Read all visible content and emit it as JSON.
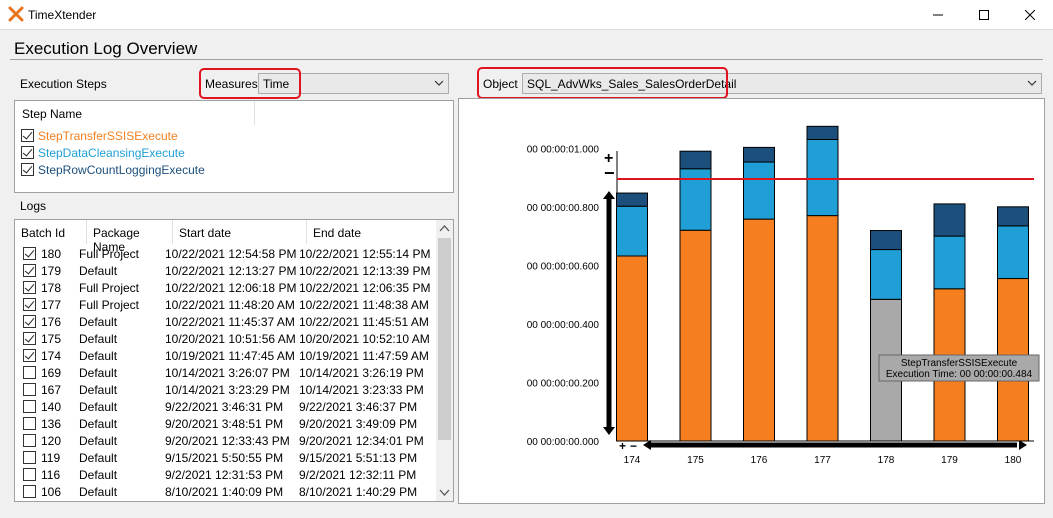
{
  "window": {
    "title": "TimeXtender"
  },
  "page": {
    "heading": "Execution Log Overview"
  },
  "controls": {
    "execution_steps_label": "Execution Steps",
    "measures_label": "Measures",
    "measures_value": "Time",
    "object_label": "Object",
    "object_value": "SQL_AdvWks_Sales_SalesOrderDetail"
  },
  "steps": {
    "header": "Step Name",
    "items": [
      {
        "label": "StepTransferSSISExecute",
        "checked": true,
        "color": "#f57f1f"
      },
      {
        "label": "StepDataCleansingExecute",
        "checked": true,
        "color": "#1f9fd5"
      },
      {
        "label": "StepRowCountLoggingExecute",
        "checked": true,
        "color": "#1c4f7c"
      }
    ]
  },
  "logs": {
    "label": "Logs",
    "columns": [
      "Batch Id",
      "Package Name",
      "Start date",
      "End date"
    ],
    "rows": [
      {
        "checked": true,
        "batch": "180",
        "package": "Full Project",
        "start": "10/22/2021 12:54:58 PM",
        "end": "10/22/2021 12:55:14 PM"
      },
      {
        "checked": true,
        "batch": "179",
        "package": "Default",
        "start": "10/22/2021 12:13:27 PM",
        "end": "10/22/2021 12:13:39 PM"
      },
      {
        "checked": true,
        "batch": "178",
        "package": "Full Project",
        "start": "10/22/2021 12:06:18 PM",
        "end": "10/22/2021 12:06:35 PM"
      },
      {
        "checked": true,
        "batch": "177",
        "package": "Full Project",
        "start": "10/22/2021 11:48:20 AM",
        "end": "10/22/2021 11:48:38 AM"
      },
      {
        "checked": true,
        "batch": "176",
        "package": "Default",
        "start": "10/22/2021 11:45:37 AM",
        "end": "10/22/2021 11:45:51 AM"
      },
      {
        "checked": true,
        "batch": "175",
        "package": "Default",
        "start": "10/20/2021 10:51:56 AM",
        "end": "10/20/2021 10:52:10 AM"
      },
      {
        "checked": true,
        "batch": "174",
        "package": "Default",
        "start": "10/19/2021 11:47:45 AM",
        "end": "10/19/2021 11:47:59 AM"
      },
      {
        "checked": false,
        "batch": "169",
        "package": "Default",
        "start": "10/14/2021 3:26:07 PM",
        "end": "10/14/2021 3:26:19 PM"
      },
      {
        "checked": false,
        "batch": "167",
        "package": "Default",
        "start": "10/14/2021 3:23:29 PM",
        "end": "10/14/2021 3:23:33 PM"
      },
      {
        "checked": false,
        "batch": "140",
        "package": "Default",
        "start": "9/22/2021 3:46:31 PM",
        "end": "9/22/2021 3:46:37 PM"
      },
      {
        "checked": false,
        "batch": "136",
        "package": "Default",
        "start": "9/20/2021 3:48:51 PM",
        "end": "9/20/2021 3:49:09 PM"
      },
      {
        "checked": false,
        "batch": "120",
        "package": "Default",
        "start": "9/20/2021 12:33:43 PM",
        "end": "9/20/2021 12:34:01 PM"
      },
      {
        "checked": false,
        "batch": "119",
        "package": "Default",
        "start": "9/15/2021 5:50:55 PM",
        "end": "9/15/2021 5:51:13 PM"
      },
      {
        "checked": false,
        "batch": "116",
        "package": "Default",
        "start": "9/2/2021 12:31:53 PM",
        "end": "9/2/2021 12:32:11 PM"
      },
      {
        "checked": false,
        "batch": "106",
        "package": "Default",
        "start": "8/10/2021 1:40:09 PM",
        "end": "8/10/2021 1:40:29 PM"
      }
    ]
  },
  "tooltip": {
    "title": "StepTransferSSISExecute",
    "text": "Execution Time: 00 00:00:00.484"
  },
  "chart_data": {
    "type": "bar",
    "stacked": true,
    "categories": [
      "174",
      "175",
      "176",
      "177",
      "178",
      "179",
      "180"
    ],
    "series": [
      {
        "name": "StepTransferSSISExecute",
        "color": "#f57f1f",
        "values": [
          0.632,
          0.72,
          0.758,
          0.77,
          0.484,
          0.52,
          0.555
        ]
      },
      {
        "name": "StepDataCleansingExecute",
        "color": "#1f9fd5",
        "values": [
          0.17,
          0.21,
          0.195,
          0.26,
          0.17,
          0.18,
          0.18
        ]
      },
      {
        "name": "StepRowCountLoggingExecute",
        "color": "#1c4f7c",
        "values": [
          0.045,
          0.06,
          0.05,
          0.045,
          0.065,
          0.11,
          0.065
        ]
      }
    ],
    "highlight": {
      "category": "178",
      "series": "StepTransferSSISExecute",
      "color": "#a9a9a9"
    },
    "threshold": {
      "value": 0.895,
      "color": "#e0141e"
    },
    "ylim": [
      0,
      1.1
    ],
    "yticks": [
      0,
      0.2,
      0.4,
      0.6,
      0.8,
      1.0
    ],
    "ytick_labels": [
      "00 00:00:00.000",
      "00 00:00:00.200",
      "00 00:00:00.400",
      "00 00:00:00.600",
      "00 00:00:00.800",
      "00 00:00:01.000"
    ],
    "grid": false
  }
}
